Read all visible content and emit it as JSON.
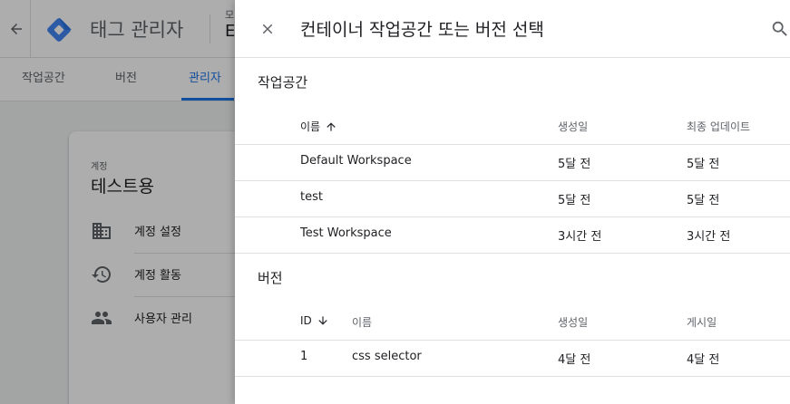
{
  "app": {
    "title": "태그 관리자",
    "account_header_small": "모",
    "account_header_large": "E"
  },
  "tabs": [
    {
      "label": "작업공간"
    },
    {
      "label": "버전"
    },
    {
      "label": "관리자",
      "active": true
    }
  ],
  "account_card": {
    "type_label": "계정",
    "name": "테스트용",
    "menu": [
      {
        "label": "계정 설정",
        "icon": "domain-icon"
      },
      {
        "label": "계정 활동",
        "icon": "history-icon"
      },
      {
        "label": "사용자 관리",
        "icon": "people-icon"
      }
    ]
  },
  "panel": {
    "title": "컨테이너 작업공간 또는 버전 선택",
    "workspaces": {
      "section_title": "작업공간",
      "columns": {
        "name": "이름",
        "created": "생성일",
        "updated": "최종 업데이트"
      },
      "rows": [
        {
          "name": "Default Workspace",
          "created": "5달 전",
          "updated": "5달 전"
        },
        {
          "name": "test",
          "created": "5달 전",
          "updated": "5달 전"
        },
        {
          "name": "Test Workspace",
          "created": "3시간 전",
          "updated": "3시간 전"
        }
      ]
    },
    "versions": {
      "section_title": "버전",
      "columns": {
        "id": "ID",
        "name": "이름",
        "created": "생성일",
        "published": "게시일"
      },
      "rows": [
        {
          "id": "1",
          "name": "css selector",
          "created": "4달 전",
          "published": "4달 전"
        }
      ]
    }
  },
  "colors": {
    "accent": "#1a73e8",
    "logo_blue": "#4285f4",
    "logo_dark": "#1967d2"
  }
}
